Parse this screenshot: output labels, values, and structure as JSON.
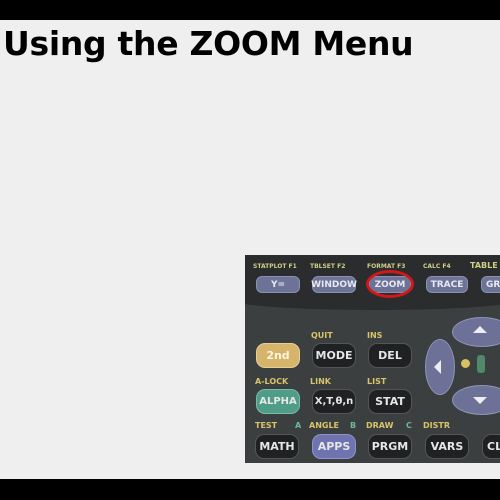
{
  "slide": {
    "title": "Using the ZOOM Menu"
  },
  "calculator": {
    "top_labels": [
      "STATPLOT F1",
      "TBLSET F2",
      "FORMAT F3",
      "CALC F4",
      "TABLE"
    ],
    "top_keys": [
      "Y=",
      "WINDOW",
      "ZOOM",
      "TRACE",
      "GR"
    ],
    "highlighted_key": "ZOOM",
    "highlight_color": "#d01818",
    "row2_labels": [
      "QUIT",
      "INS"
    ],
    "row2_keys": [
      "2nd",
      "MODE",
      "DEL"
    ],
    "row3_labels": [
      "A-LOCK",
      "LINK",
      "LIST"
    ],
    "row3_keys": [
      "ALPHA",
      "X,T,θ,n",
      "STAT"
    ],
    "row4_labels": [
      "TEST",
      "A",
      "ANGLE",
      "B",
      "DRAW",
      "C",
      "DISTR"
    ],
    "row4_keys": [
      "MATH",
      "APPS",
      "PRGM",
      "VARS",
      "CL"
    ],
    "colors": {
      "second_key": "#d6b46c",
      "alpha_key": "#4f9c88",
      "apps_key": "#6f73b0",
      "body": "#3c3f40"
    }
  }
}
